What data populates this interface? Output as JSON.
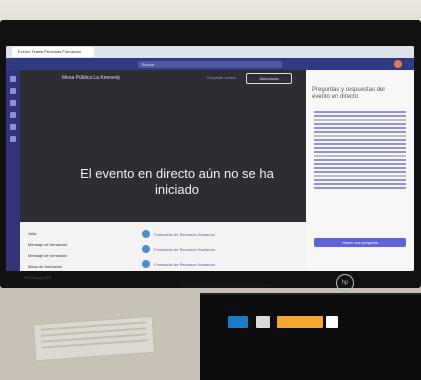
{
  "browser": {
    "tab_title": "Evento Teams Personas Formacion"
  },
  "teams": {
    "search_placeholder": "Buscar",
    "event_title": "Mesa Pública La Kennedy",
    "share_link": "Compartir enlace",
    "leave_label": "Abandonar",
    "status_message": "El evento en directo aún no se ha iniciado"
  },
  "qa_panel": {
    "title": "Preguntas y respuestas del evento en directo",
    "button_label": "Hacer una pregunta"
  },
  "chat": {
    "items": [
      "Julia",
      "Mensaje de formación",
      "Mensaje de formación",
      "Mesa de formación"
    ],
    "notifications": [
      "Formación de Recursos Humanos",
      "Formación de Recursos Humanos",
      "Formación de Recursos Humanos"
    ]
  },
  "hardware": {
    "monitor_brand": "ProDisplay 800",
    "logo_text": "hp"
  },
  "colors": {
    "teams_purple": "#2f3c82",
    "event_background": "#2d2d33",
    "accent": "#5e63d6"
  },
  "icons": [
    "search-icon",
    "profile-avatar-icon",
    "teams-rail-icons",
    "windows-start-icon"
  ]
}
